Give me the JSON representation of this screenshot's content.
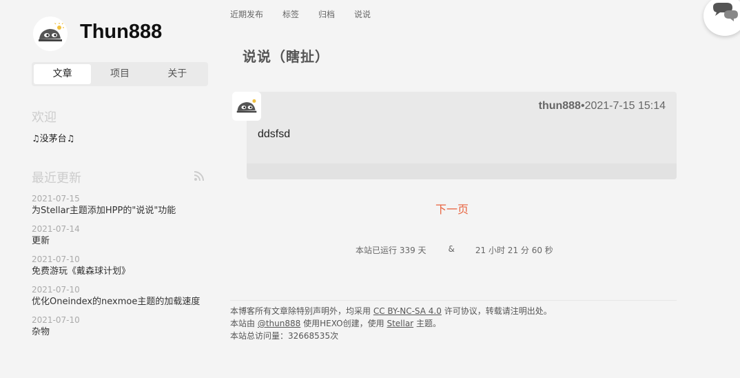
{
  "site": {
    "title": "Thun888"
  },
  "sidebar": {
    "tabs": [
      {
        "label": "文章"
      },
      {
        "label": "项目"
      },
      {
        "label": "关于"
      }
    ],
    "welcome_title": "欢迎",
    "welcome_text": "♫没茅台♫",
    "recent_title": "最近更新",
    "recent_posts": [
      {
        "date": "2021-07-15",
        "title": "为Stellar主题添加HPP的\"说说\"功能"
      },
      {
        "date": "2021-07-14",
        "title": "更新"
      },
      {
        "date": "2021-07-10",
        "title": "免费游玩《戴森球计划》"
      },
      {
        "date": "2021-07-10",
        "title": "优化Oneindex的nexmoe主题的加载速度"
      },
      {
        "date": "2021-07-10",
        "title": "杂物"
      }
    ]
  },
  "topnav": [
    {
      "label": "近期发布"
    },
    {
      "label": "标签"
    },
    {
      "label": "归档"
    },
    {
      "label": "说说"
    }
  ],
  "page_title": "说说（瞎扯）",
  "talk": {
    "author": "thun888",
    "separator": "•",
    "time": "2021-7-15 15:14",
    "content": "ddsfsd"
  },
  "next_page": "下一页",
  "uptime": {
    "days": "本站已运行 339 天",
    "amp": "&",
    "time": "21 小时 21 分 60 秒"
  },
  "footer": {
    "line1_prefix": "本博客所有文章除特别声明外，均采用",
    "license": "CC BY-NC-SA 4.0",
    "line1_suffix": "许可协议，转载请注明出处。",
    "line2_prefix": "本站由",
    "author_link": "@thun888",
    "line2_mid": "使用HEXO创建，使用",
    "theme_link": "Stellar",
    "line2_suffix": "主题。",
    "visits": "本站总访问量：32668535次"
  },
  "colors": {
    "accent": "#e8623e",
    "card": "#e9e9e9",
    "background": "#f4f4f4"
  },
  "icons": {
    "avatar": "cartoon-ghost-avatar-icon",
    "rss": "rss-icon",
    "comment": "chat-bubbles-icon"
  }
}
